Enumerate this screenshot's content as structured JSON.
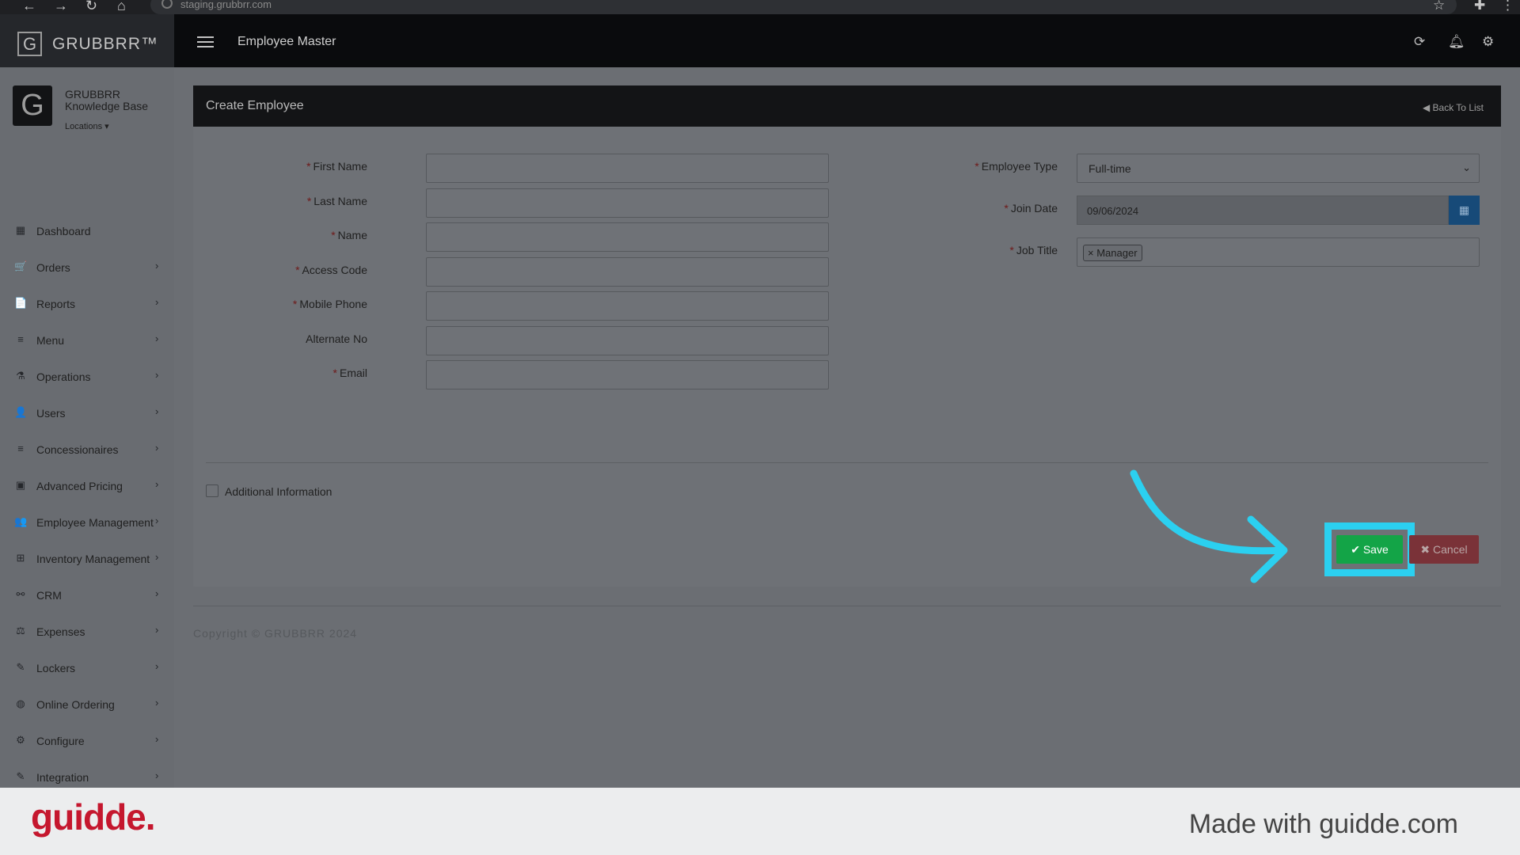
{
  "browser": {
    "url": "staging.grubbrr.com"
  },
  "app": {
    "brand": "GRUBBRR™",
    "page_heading": "Employee Master"
  },
  "profile": {
    "name": "GRUBBRR Knowledge Base",
    "locations_label": "Locations"
  },
  "sidebar": {
    "items": [
      {
        "label": "Dashboard",
        "icon": "dashboard-icon",
        "glyph": "▦",
        "has_children": false
      },
      {
        "label": "Orders",
        "icon": "cart-icon",
        "glyph": "🛒",
        "has_children": true
      },
      {
        "label": "Reports",
        "icon": "report-icon",
        "glyph": "📄",
        "has_children": true
      },
      {
        "label": "Menu",
        "icon": "list-icon",
        "glyph": "≡",
        "has_children": true
      },
      {
        "label": "Operations",
        "icon": "flask-icon",
        "glyph": "⚗",
        "has_children": true
      },
      {
        "label": "Users",
        "icon": "user-add-icon",
        "glyph": "👤",
        "has_children": true
      },
      {
        "label": "Concessionaires",
        "icon": "list-icon",
        "glyph": "≡",
        "has_children": true
      },
      {
        "label": "Advanced Pricing",
        "icon": "money-icon",
        "glyph": "▣",
        "has_children": true
      },
      {
        "label": "Employee Management",
        "icon": "users-icon",
        "glyph": "👥",
        "has_children": true
      },
      {
        "label": "Inventory Management",
        "icon": "sitemap-icon",
        "glyph": "⊞",
        "has_children": true
      },
      {
        "label": "CRM",
        "icon": "link-icon",
        "glyph": "⚯",
        "has_children": true
      },
      {
        "label": "Expenses",
        "icon": "balance-icon",
        "glyph": "⚖",
        "has_children": true
      },
      {
        "label": "Lockers",
        "icon": "lockers-icon",
        "glyph": "✎",
        "has_children": true
      },
      {
        "label": "Online Ordering",
        "icon": "globe-icon",
        "glyph": "◍",
        "has_children": true
      },
      {
        "label": "Configure",
        "icon": "gear-icon",
        "glyph": "⚙",
        "has_children": true
      },
      {
        "label": "Integration",
        "icon": "plug-icon",
        "glyph": "✎",
        "has_children": true
      }
    ]
  },
  "form": {
    "title": "Create Employee",
    "back_link": "Back To List",
    "left_fields": [
      {
        "label": "First Name",
        "required": true,
        "value": ""
      },
      {
        "label": "Last Name",
        "required": true,
        "value": ""
      },
      {
        "label": "Name",
        "required": true,
        "value": ""
      },
      {
        "label": "Access Code",
        "required": true,
        "value": ""
      },
      {
        "label": "Mobile Phone",
        "required": true,
        "value": ""
      },
      {
        "label": "Alternate No",
        "required": false,
        "value": ""
      },
      {
        "label": "Email",
        "required": true,
        "value": ""
      }
    ],
    "employee_type": {
      "label": "Employee Type",
      "required": true,
      "value": "Full-time"
    },
    "join_date": {
      "label": "Join Date",
      "required": true,
      "value": "09/06/2024"
    },
    "job_title": {
      "label": "Job Title",
      "required": true,
      "tags": [
        "Manager"
      ]
    },
    "additional_info_label": "Additional Information",
    "additional_info_checked": false,
    "save_label": "Save",
    "cancel_label": "Cancel"
  },
  "copyright": "Copyright © GRUBBRR 2024",
  "footer": {
    "logo": "guidde.",
    "made_with": "Made with guidde.com"
  },
  "colors": {
    "save": "#13a447",
    "highlight": "#2bd0f0",
    "guidde_red": "#c5172e"
  }
}
